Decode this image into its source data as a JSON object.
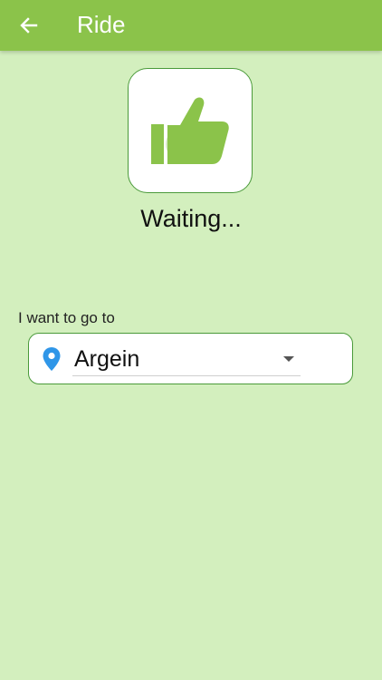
{
  "app_bar": {
    "title": "Ride",
    "back_icon": "arrow-left-icon",
    "color": "#8bc34a"
  },
  "status": {
    "icon": "thumbs-up-icon",
    "text": "Waiting..."
  },
  "destination": {
    "label": "I want to go to",
    "icon": "location-pin-icon",
    "selected": "Argein",
    "dropdown_icon": "dropdown-arrow-icon"
  },
  "colors": {
    "background": "#d3efbe",
    "accent": "#8bc34a",
    "pin": "#2f96e8",
    "border": "#4a9a3a"
  }
}
